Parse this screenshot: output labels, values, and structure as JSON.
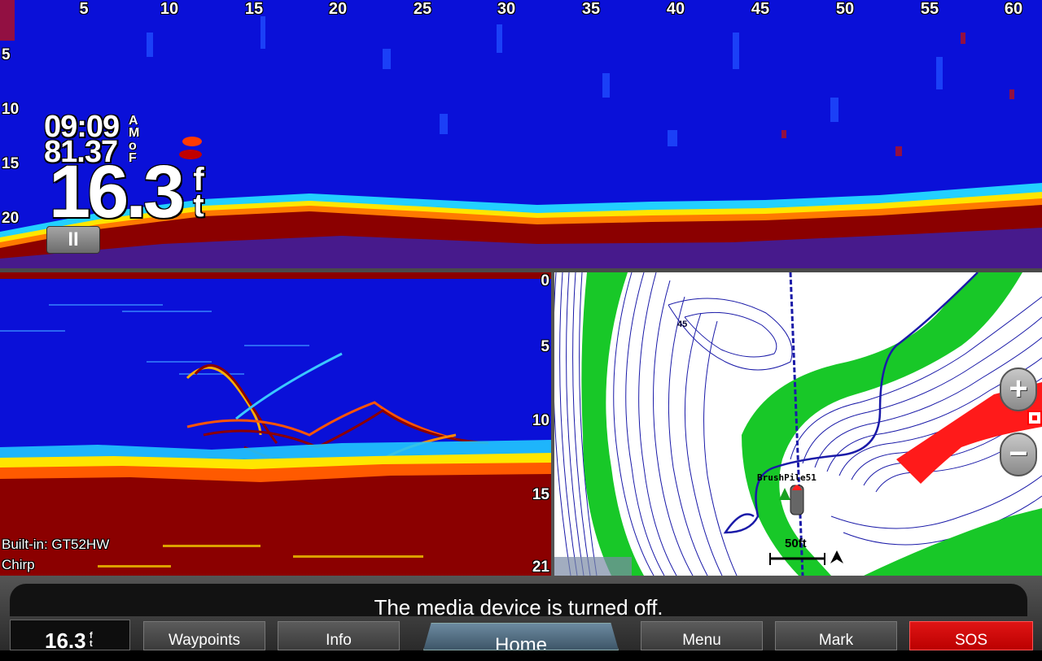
{
  "top_sonar": {
    "range_labels": [
      "5",
      "10",
      "15",
      "20",
      "25",
      "30",
      "35",
      "40",
      "45",
      "50",
      "55",
      "60"
    ],
    "depth_labels": [
      "5",
      "10",
      "15",
      "20"
    ],
    "time": "09:09",
    "time_unit": [
      "A",
      "M"
    ],
    "water_temp": "81.37",
    "temp_unit": [
      "o",
      "F"
    ],
    "depth": "16.3",
    "depth_unit": [
      "f",
      "t"
    ],
    "pause_label": "II"
  },
  "bottom_sonar": {
    "scale_labels": [
      "0",
      "5",
      "10",
      "15",
      "21"
    ],
    "transducer": "Built-in: GT52HW",
    "mode": "Chirp"
  },
  "map": {
    "waypoint_label": "BrushPile51",
    "contour_label": "45",
    "scale_label": "50ft",
    "zoom_in": "+",
    "zoom_out": "−"
  },
  "bottom_bar": {
    "message": "The media device is turned off.",
    "depth_value": "16.3",
    "depth_unit": [
      "f",
      "t"
    ],
    "buttons": {
      "waypoints": "Waypoints",
      "info": "Info",
      "home": "Home",
      "menu": "Menu",
      "mark": "Mark",
      "sos": "SOS"
    }
  },
  "colors": {
    "water": "#0a10d8",
    "strong_return": "#8b0000",
    "shallow_zone": "#18c828",
    "danger_zone": "#ff1a1a",
    "sos": "#e01515"
  }
}
